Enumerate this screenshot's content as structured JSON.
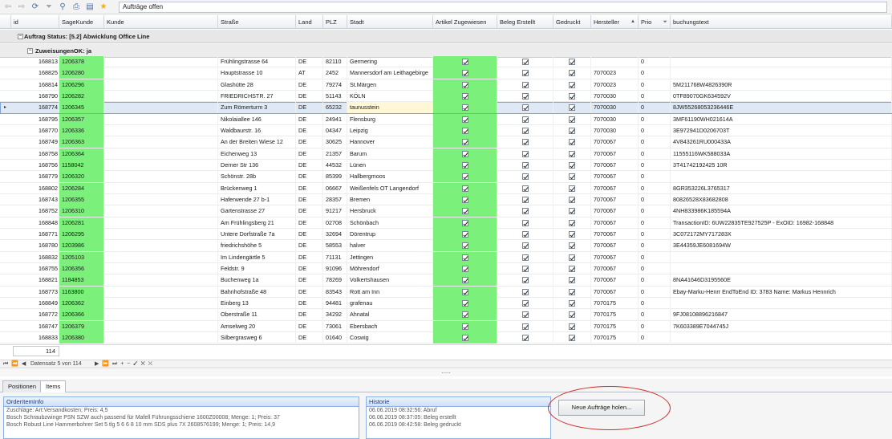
{
  "toolbar": {
    "icons": [
      "back-arrow-icon",
      "forward-arrow-icon",
      "refresh-icon",
      "filter-icon",
      "search-icon",
      "print-icon",
      "export-icon",
      "star-icon"
    ],
    "view_name": "Aufträge offen"
  },
  "columns": [
    {
      "key": "id",
      "label": "id"
    },
    {
      "key": "sagekunde",
      "label": "SageKunde"
    },
    {
      "key": "kunde",
      "label": "Kunde"
    },
    {
      "key": "strasse",
      "label": "Straße"
    },
    {
      "key": "land",
      "label": "Land"
    },
    {
      "key": "plz",
      "label": "PLZ"
    },
    {
      "key": "stadt",
      "label": "Stadt"
    },
    {
      "key": "artikel",
      "label": "Artikel Zugewiesen"
    },
    {
      "key": "beleg",
      "label": "Beleg Erstellt"
    },
    {
      "key": "gedruckt",
      "label": "Gedruckt"
    },
    {
      "key": "hersteller",
      "label": "Hersteller"
    },
    {
      "key": "prio",
      "label": "Prio"
    },
    {
      "key": "buchungstext",
      "label": "buchungstext"
    }
  ],
  "groups": {
    "level1": "Auftrag Status: [5.2] Abwicklung Office Line",
    "level2": "ZuweisungenOK: ja"
  },
  "rows": [
    {
      "id": "168813",
      "sage": "1206378",
      "kunde": "",
      "strasse": "Frühlingstrasse 64",
      "land": "DE",
      "plz": "82110",
      "stadt": "Germering",
      "hersteller": "",
      "prio": "0",
      "buchung": ""
    },
    {
      "id": "168825",
      "sage": "1206280",
      "kunde": "",
      "strasse": "Hauptstrasse 10",
      "land": "AT",
      "plz": "2452",
      "stadt": "Mannersdorf am Leithagebirge",
      "hersteller": "7070023",
      "prio": "0",
      "buchung": ""
    },
    {
      "id": "168814",
      "sage": "1206296",
      "kunde": "",
      "strasse": "Glashütte 28",
      "land": "DE",
      "plz": "79274",
      "stadt": "St.Märgen",
      "hersteller": "7070023",
      "prio": "0",
      "buchung": "5M211768W4826390R"
    },
    {
      "id": "168790",
      "sage": "1206282",
      "kunde": "",
      "strasse": "FRIEDRICHSTR. 27",
      "land": "DE",
      "plz": "51143",
      "stadt": "KÖLN",
      "hersteller": "7070030",
      "prio": "0",
      "buchung": "0TF89070GK634592V"
    },
    {
      "id": "168774",
      "sage": "1206345",
      "kunde": "",
      "strasse": "Zum Römerturm 3",
      "land": "DE",
      "plz": "65232",
      "stadt": "taunusstein",
      "hersteller": "7070030",
      "prio": "0",
      "buchung": "8JW55268053236446E",
      "selected": true
    },
    {
      "id": "168795",
      "sage": "1206357",
      "kunde": "",
      "strasse": "Nikolaiallee 146",
      "land": "DE",
      "plz": "24941",
      "stadt": "Flensburg",
      "hersteller": "7070030",
      "prio": "0",
      "buchung": "3MF61190WH021614A"
    },
    {
      "id": "168770",
      "sage": "1206336",
      "kunde": "",
      "strasse": "Waldbaurstr. 16",
      "land": "DE",
      "plz": "04347",
      "stadt": "Leipzig",
      "hersteller": "7070030",
      "prio": "0",
      "buchung": "3E972941D0206703T"
    },
    {
      "id": "168749",
      "sage": "1206363",
      "kunde": "",
      "strasse": "An der Breiten Wiese 12",
      "land": "DE",
      "plz": "30625",
      "stadt": "Hannover",
      "hersteller": "7070067",
      "prio": "0",
      "buchung": "4V843261RU000433A"
    },
    {
      "id": "168758",
      "sage": "1206364",
      "kunde": "",
      "strasse": "Eichenweg 13",
      "land": "DE",
      "plz": "21357",
      "stadt": "Barum",
      "hersteller": "7070067",
      "prio": "0",
      "buchung": "11555116WK588033A"
    },
    {
      "id": "168756",
      "sage": "1158042",
      "kunde": "",
      "strasse": "Derner Str 136",
      "land": "DE",
      "plz": "44532",
      "stadt": "Lünen",
      "hersteller": "7070067",
      "prio": "0",
      "buchung": "3T41742192425 10R"
    },
    {
      "id": "168779",
      "sage": "1206320",
      "kunde": "",
      "strasse": "Schönstr. 28b",
      "land": "DE",
      "plz": "85399",
      "stadt": "Hallbergmoos",
      "hersteller": "7070067",
      "prio": "0",
      "buchung": ""
    },
    {
      "id": "168802",
      "sage": "1206284",
      "kunde": "",
      "strasse": "Brückenweg 1",
      "land": "DE",
      "plz": "06667",
      "stadt": "Weißenfels OT Langendorf",
      "hersteller": "7070067",
      "prio": "0",
      "buchung": "8GR353226L3765317"
    },
    {
      "id": "168743",
      "sage": "1206355",
      "kunde": "",
      "strasse": "Haferwende 27 b-1",
      "land": "DE",
      "plz": "28357",
      "stadt": "Bremen",
      "hersteller": "7070067",
      "prio": "0",
      "buchung": "80826528X83682808"
    },
    {
      "id": "168752",
      "sage": "1206310",
      "kunde": "",
      "strasse": "Gartenstrasse 27",
      "land": "DE",
      "plz": "91217",
      "stadt": "Hersbruck",
      "hersteller": "7070067",
      "prio": "0",
      "buchung": "4NH833986K185594A"
    },
    {
      "id": "168848",
      "sage": "1206281",
      "kunde": "",
      "strasse": "Am Frühlingsberg 21",
      "land": "DE",
      "plz": "02708",
      "stadt": "Schönbach",
      "hersteller": "7070067",
      "prio": "0",
      "buchung": "TransactionID: 6UW22835TE927525P - ExOID: 16982-168848"
    },
    {
      "id": "168771",
      "sage": "1206295",
      "kunde": "",
      "strasse": "Untere Dorfstraße 7a",
      "land": "DE",
      "plz": "32694",
      "stadt": "Dörentrup",
      "hersteller": "7070067",
      "prio": "0",
      "buchung": "3C072172MY717283X"
    },
    {
      "id": "168780",
      "sage": "1203986",
      "kunde": "",
      "strasse": "friedrichshöhe 5",
      "land": "DE",
      "plz": "58553",
      "stadt": "halver",
      "hersteller": "7070067",
      "prio": "0",
      "buchung": "3E44359JE6081694W"
    },
    {
      "id": "168832",
      "sage": "1205103",
      "kunde": "",
      "strasse": "Im Lindengärtle 5",
      "land": "DE",
      "plz": "71131",
      "stadt": "Jettingen",
      "hersteller": "7070067",
      "prio": "0",
      "buchung": ""
    },
    {
      "id": "168755",
      "sage": "1206356",
      "kunde": "",
      "strasse": "Feldstr. 9",
      "land": "DE",
      "plz": "91096",
      "stadt": "Möhrendorf",
      "hersteller": "7070067",
      "prio": "0",
      "buchung": ""
    },
    {
      "id": "168821",
      "sage": "1184853",
      "kunde": "",
      "strasse": "Buchenweg 1a",
      "land": "DE",
      "plz": "78269",
      "stadt": "Volkertshausen",
      "hersteller": "7070067",
      "prio": "0",
      "buchung": "8NA41646D3195560E"
    },
    {
      "id": "168773",
      "sage": "1163800",
      "kunde": "",
      "strasse": "Bahnhofstraße 48",
      "land": "DE",
      "plz": "83543",
      "stadt": "Rott am Inn",
      "hersteller": "7070067",
      "prio": "0",
      "buchung": "Ebay-Marku-Henrr EndToEnd ID: 3783 Name: Markus Hennrich"
    },
    {
      "id": "168849",
      "sage": "1206362",
      "kunde": "",
      "strasse": "Einberg 13",
      "land": "DE",
      "plz": "94481",
      "stadt": "grafenau",
      "hersteller": "7070175",
      "prio": "0",
      "buchung": ""
    },
    {
      "id": "168772",
      "sage": "1206366",
      "kunde": "",
      "strasse": "Oberstraße 11",
      "land": "DE",
      "plz": "34292",
      "stadt": "Ahnatal",
      "hersteller": "7070175",
      "prio": "0",
      "buchung": "9FJ08108896216847"
    },
    {
      "id": "168747",
      "sage": "1206379",
      "kunde": "",
      "strasse": "Amselweg 20",
      "land": "DE",
      "plz": "73061",
      "stadt": "Ebersbach",
      "hersteller": "7070175",
      "prio": "0",
      "buchung": "7K603389E7044745J"
    },
    {
      "id": "168833",
      "sage": "1206380",
      "kunde": "",
      "strasse": "Silbergrasweg 6",
      "land": "DE",
      "plz": "01640",
      "stadt": "Coswig",
      "hersteller": "7070175",
      "prio": "0",
      "buchung": ""
    }
  ],
  "footer": {
    "row_count": "114",
    "navigator_prev": "⏮ ⏪ ◀",
    "navigator_text": "Datensatz 5 von 114",
    "navigator_next": "▶ ⏩ ⏭ + − ✓ ✕ ⛌",
    "splitter_grip": "....."
  },
  "tabs": [
    {
      "label": "Positionen",
      "active": false
    },
    {
      "label": "Items",
      "active": true
    }
  ],
  "order_item_info": {
    "title": "OrderItemInfo",
    "lines": [
      "Zuschläge: Art:Versandkosten; Preis: 4,5",
      "Bosch Schraubzwinge PSN SZW auch passend für Mafell Führungsschiene 1600Z00008; Menge: 1; Preis: 37",
      "Bosch Robust Line Hammerbohrer Set 5 tlg 5 6 6 8 10 mm SDS plus 7X  2608576199; Menge: 1; Preis: 14,9"
    ]
  },
  "historie": {
    "title": "Historie",
    "lines": [
      "06.06.2019 08:32:56: Abruf",
      "06.06.2019 08:37:05: Beleg erstellt",
      "06.06.2019 08:42:58: Beleg gedruckt"
    ]
  },
  "fetch_button": {
    "label": "Neue Aufträge holen..."
  },
  "colors": {
    "green": "#7bf07b",
    "selected_row": "#dfe9f6",
    "annotation_red": "#d22a2a"
  }
}
